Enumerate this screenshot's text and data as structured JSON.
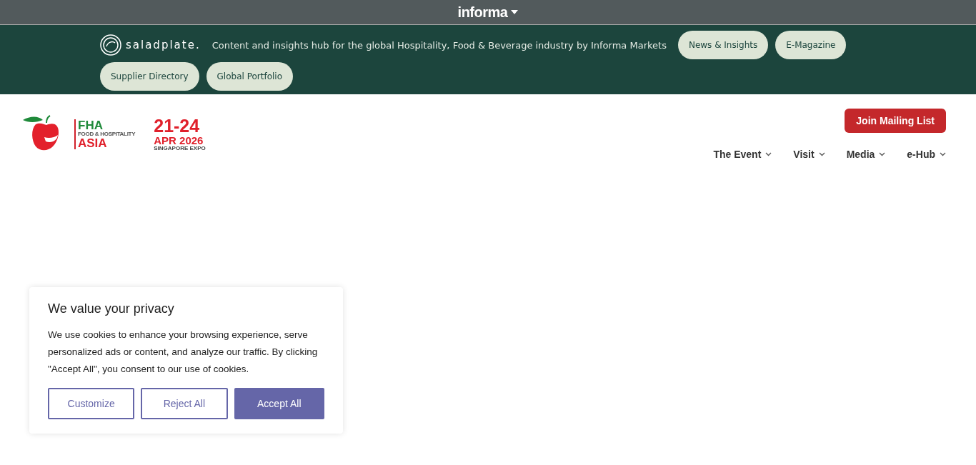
{
  "top_bar": {
    "brand": "informa"
  },
  "saladplate_bar": {
    "logo_text": "saladplate.",
    "tagline": "Content and insights hub for the global Hospitality, Food & Beverage industry by Informa Markets",
    "links": [
      "News & Insights",
      "E-Magazine",
      "Supplier Directory",
      "Global Portfolio"
    ]
  },
  "header": {
    "logo": {
      "short": "FHA",
      "line": "FOOD & HOSPITALITY",
      "region": "ASIA"
    },
    "event_date": {
      "days": "21-24",
      "month_year": "APR 2026",
      "venue": "SINGAPORE EXPO"
    },
    "cta": "Join Mailing List",
    "nav": [
      "The Event",
      "Visit",
      "Media",
      "e-Hub"
    ]
  },
  "cookie_banner": {
    "title": "We value your privacy",
    "text": "We use cookies to enhance your browsing experience, serve personalized ads or content, and analyze our traffic. By clicking \"Accept All\", you consent to our use of cookies.",
    "buttons": [
      {
        "label": "Customize",
        "kind": "outline"
      },
      {
        "label": "Reject All",
        "kind": "outline"
      },
      {
        "label": "Accept All",
        "kind": "filled"
      }
    ]
  }
}
